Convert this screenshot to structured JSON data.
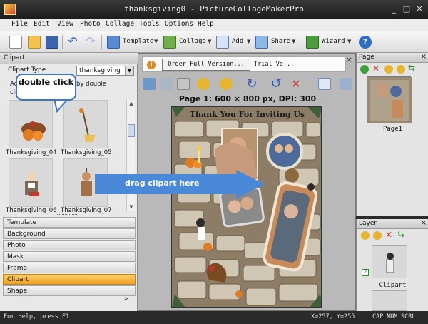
{
  "window": {
    "title": "thanksgiving0 - PictureCollageMakerPro",
    "controls": [
      "_",
      "□",
      "✕"
    ]
  },
  "menu": [
    "File",
    "Edit",
    "View",
    "Photo",
    "Collage",
    "Tools",
    "Options",
    "Help"
  ],
  "toolbar": {
    "template_label": "Template",
    "collage_label": "Collage",
    "add_label": "Add",
    "share_label": "Share",
    "wizard_label": "Wizard",
    "icons": [
      "new-icon",
      "open-icon",
      "save-icon",
      "undo-icon",
      "redo-icon",
      "template-icon",
      "collage-icon",
      "add-icon",
      "share-icon",
      "wizard-icon",
      "help-icon"
    ]
  },
  "clipart_panel": {
    "header": "Clipart",
    "type_label": "Clipart Type",
    "type_value": "thanksgiving",
    "hint": "Add clipart to collage by double clicking",
    "items": [
      {
        "label": "Thanksgiving_04"
      },
      {
        "label": "Thanksgiving_05"
      },
      {
        "label": "Thanksgiving_06"
      },
      {
        "label": "Thanksgiving_07"
      }
    ]
  },
  "tabs": [
    {
      "label": "Template",
      "active": false
    },
    {
      "label": "Background",
      "active": false
    },
    {
      "label": "Photo",
      "active": false
    },
    {
      "label": "Mask",
      "active": false
    },
    {
      "label": "Frame",
      "active": false
    },
    {
      "label": "Clipart",
      "active": true
    },
    {
      "label": "Shape",
      "active": false
    }
  ],
  "tabs_more": "»",
  "info_bar": {
    "icon": "i",
    "order_button": "Order Full Version...",
    "trial_text": "Trial Ve...",
    "close": "×"
  },
  "canvas": {
    "page_info": "Page 1: 600 × 800 px, DPI: 300",
    "collage_title": "Thank You For Inviting Us"
  },
  "annotations": {
    "bubble": "double click",
    "drag": "drag clipart here"
  },
  "page_panel": {
    "header": "Page",
    "close": "×",
    "thumb_label": "Page1"
  },
  "layer_panel": {
    "header": "Layer",
    "close": "×",
    "item_label": "Clipart",
    "checked_mark": "✓"
  },
  "status": {
    "help": "For Help, press F1",
    "coords": "X=257, Y=255",
    "indicators": [
      "CAP",
      "NUM",
      "SCRL"
    ]
  },
  "colors": {
    "accent_tab": "#f0a020",
    "drag_arrow": "#4a88d8",
    "titlebar": "#1c1c1c"
  }
}
